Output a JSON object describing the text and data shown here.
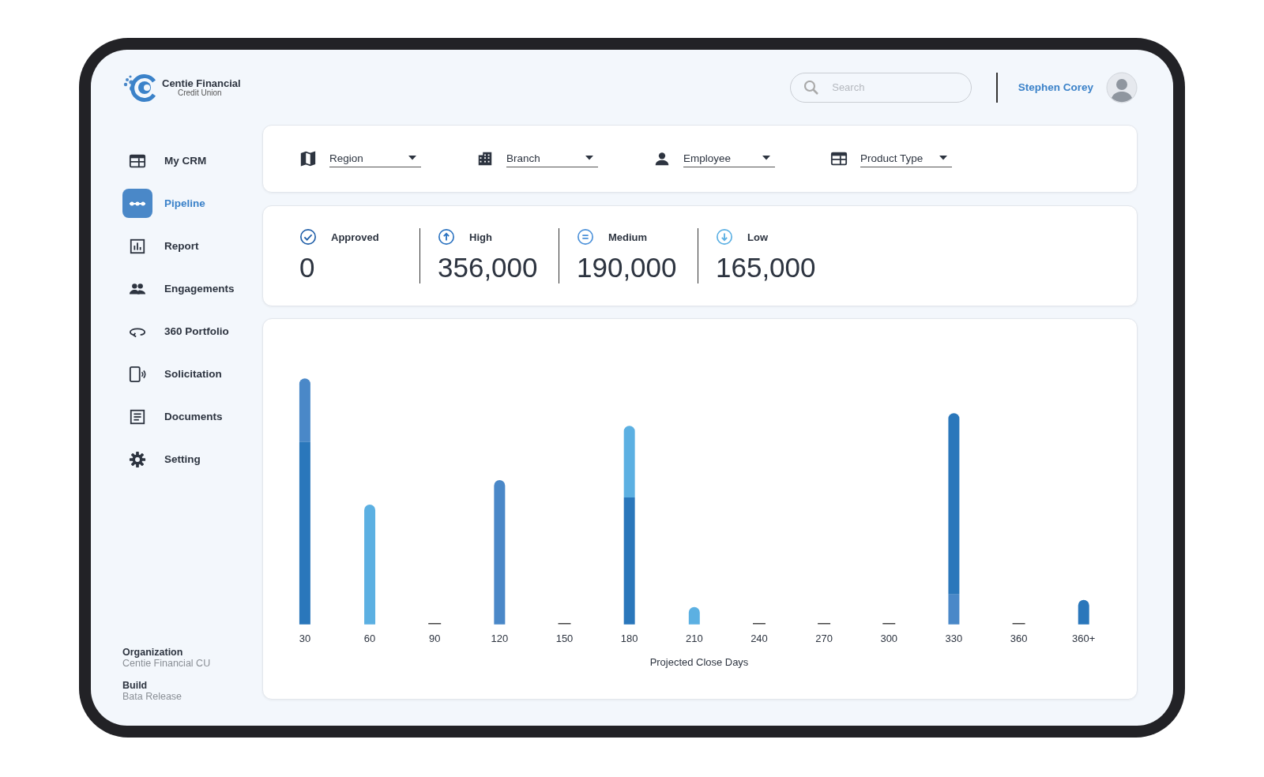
{
  "brand": {
    "name": "Centie Financial",
    "subtitle": "Credit Union"
  },
  "search": {
    "placeholder": "Search"
  },
  "user": {
    "name": "Stephen Corey"
  },
  "sidebar": {
    "items": [
      {
        "label": "My CRM",
        "kind": "crm",
        "selected": false
      },
      {
        "label": "Pipeline",
        "kind": "pipeline",
        "selected": true
      },
      {
        "label": "Report",
        "kind": "report",
        "selected": false
      },
      {
        "label": "Engagements",
        "kind": "people",
        "selected": false
      },
      {
        "label": "360 Portfolio",
        "kind": "rotate",
        "selected": false
      },
      {
        "label": "Solicitation",
        "kind": "phone",
        "selected": false
      },
      {
        "label": "Documents",
        "kind": "doc",
        "selected": false
      },
      {
        "label": "Setting",
        "kind": "gear",
        "selected": false
      }
    ],
    "footer": [
      {
        "title": "Organization",
        "value": "Centie Financial CU"
      },
      {
        "title": "Build",
        "value": "Bata Release"
      }
    ]
  },
  "filters": [
    {
      "label": "Region",
      "kind": "map"
    },
    {
      "label": "Branch",
      "kind": "building"
    },
    {
      "label": "Employee",
      "kind": "person"
    },
    {
      "label": "Product Type",
      "kind": "crm"
    }
  ],
  "stats": [
    {
      "label": "Approved",
      "value": "0",
      "kind": "check"
    },
    {
      "label": "High",
      "value": "356,000",
      "kind": "up"
    },
    {
      "label": "Medium",
      "value": "190,000",
      "kind": "equal"
    },
    {
      "label": "Low",
      "value": "165,000",
      "kind": "down"
    }
  ],
  "chart": {
    "categories": [
      "30",
      "60",
      "90",
      "120",
      "150",
      "180",
      "210",
      "240",
      "270",
      "300",
      "330",
      "360",
      "360+"
    ],
    "xlabel": "Projected Close Days"
  }
}
